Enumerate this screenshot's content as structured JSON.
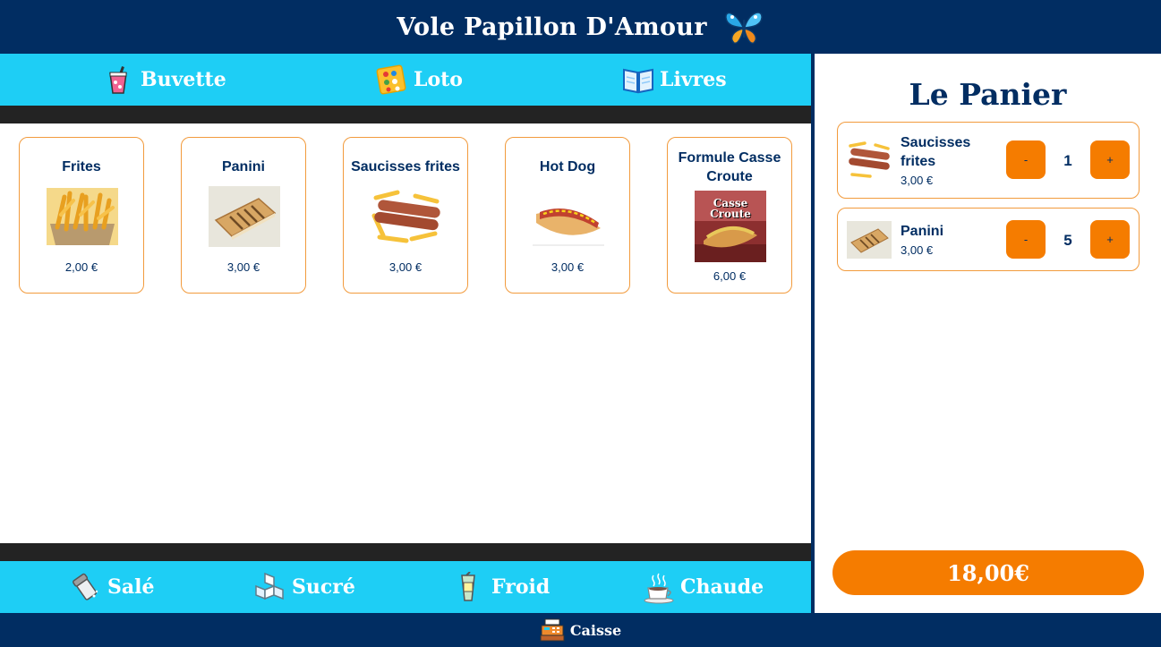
{
  "header": {
    "title": "Vole Papillon D'Amour",
    "logo_icon": "butterfly-icon"
  },
  "top_tabs": [
    {
      "label": "Buvette",
      "icon": "drink-cup-icon"
    },
    {
      "label": "Loto",
      "icon": "bingo-card-icon"
    },
    {
      "label": "Livres",
      "icon": "open-book-icon"
    }
  ],
  "products": [
    {
      "name": "Frites",
      "price": "2,00 €",
      "image": "fries-image"
    },
    {
      "name": "Panini",
      "price": "3,00 €",
      "image": "panini-image"
    },
    {
      "name": "Saucisses frites",
      "price": "3,00 €",
      "image": "sausage-fries-image"
    },
    {
      "name": "Hot Dog",
      "price": "3,00 €",
      "image": "hot-dog-image"
    },
    {
      "name": "Formule Casse Croute",
      "price": "6,00 €",
      "image": "casse-croute-image",
      "image_text": "Casse Croute"
    }
  ],
  "bottom_tabs": [
    {
      "label": "Salé",
      "icon": "salt-shaker-icon"
    },
    {
      "label": "Sucré",
      "icon": "sugar-cubes-icon"
    },
    {
      "label": "Froid",
      "icon": "cold-drink-icon"
    },
    {
      "label": "Chaude",
      "icon": "hot-cup-icon"
    }
  ],
  "cart": {
    "title": "Le Panier",
    "items": [
      {
        "name": "Saucisses frites",
        "price": "3,00 €",
        "quantity": "1",
        "minus_label": "-",
        "plus_label": "+"
      },
      {
        "name": "Panini",
        "price": "3,00 €",
        "quantity": "5",
        "minus_label": "-",
        "plus_label": "+"
      }
    ],
    "total": "18,00€"
  },
  "footer": {
    "label": "Caisse",
    "icon": "cash-register-icon"
  },
  "colors": {
    "navy": "#012d62",
    "cyan": "#1ecef5",
    "orange": "#f57c00",
    "card_border": "#f29b3d",
    "band": "#232323"
  }
}
